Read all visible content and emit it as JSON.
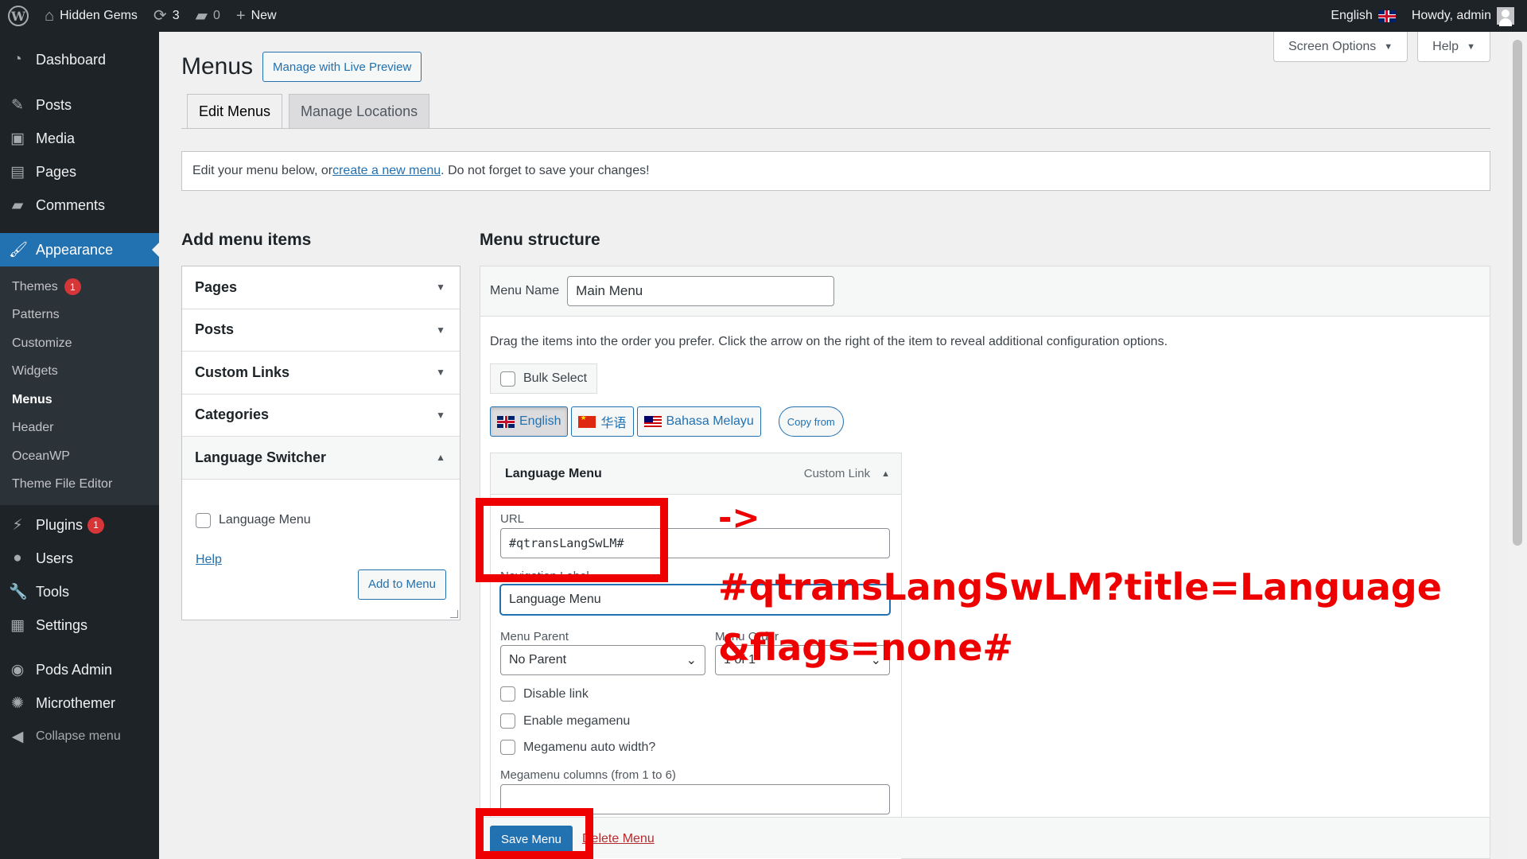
{
  "adminbar": {
    "site_name": "Hidden Gems",
    "updates_count": "3",
    "comments_count": "0",
    "new_label": "New",
    "language": "English",
    "howdy": "Howdy, admin"
  },
  "sidebar": {
    "dashboard": "Dashboard",
    "posts": "Posts",
    "media": "Media",
    "pages": "Pages",
    "comments": "Comments",
    "appearance": "Appearance",
    "sub": {
      "themes": "Themes",
      "themes_badge": "1",
      "patterns": "Patterns",
      "customize": "Customize",
      "widgets": "Widgets",
      "menus": "Menus",
      "header": "Header",
      "oceanwp": "OceanWP",
      "theme_file_editor": "Theme File Editor"
    },
    "plugins": "Plugins",
    "plugins_badge": "1",
    "users": "Users",
    "tools": "Tools",
    "settings": "Settings",
    "pods_admin": "Pods Admin",
    "microthemer": "Microthemer",
    "collapse": "Collapse menu"
  },
  "screen_meta": {
    "screen_options": "Screen Options",
    "help": "Help"
  },
  "page": {
    "title": "Menus",
    "live_preview": "Manage with Live Preview",
    "tabs": [
      "Edit Menus",
      "Manage Locations"
    ],
    "notice_prefix": "Edit your menu below, or ",
    "notice_link": "create a new menu",
    "notice_suffix": ". Do not forget to save your changes!"
  },
  "add_items": {
    "heading": "Add menu items",
    "sections": [
      "Pages",
      "Posts",
      "Custom Links",
      "Categories",
      "Language Switcher"
    ],
    "checkbox_label": "Language Menu",
    "help": "Help",
    "add_button": "Add to Menu"
  },
  "structure": {
    "heading": "Menu structure",
    "menu_name_label": "Menu Name",
    "menu_name_value": "Main Menu",
    "instruction": "Drag the items into the order you prefer. Click the arrow on the right of the item to reveal additional configuration options.",
    "bulk_select": "Bulk Select",
    "languages": [
      "English",
      "华语",
      "Bahasa Melayu"
    ],
    "copy_from": "Copy from",
    "item": {
      "title": "Language Menu",
      "type": "Custom Link",
      "url_label": "URL",
      "url_value": "#qtransLangSwLM#",
      "nav_label_label": "Navigation Label",
      "nav_label_value": "Language Menu",
      "parent_label": "Menu Parent",
      "parent_value": "No Parent",
      "order_label": "Menu Order",
      "order_value": "1 of 1",
      "disable_link": "Disable link",
      "enable_megamenu": "Enable megamenu",
      "megamenu_auto": "Megamenu auto width?",
      "megamenu_columns": "Megamenu columns (from 1 to 6)"
    },
    "save": "Save Menu",
    "delete": "Delete Menu"
  },
  "annotation": {
    "arrow": "->",
    "line1": "#qtransLangSwLM?title=Language",
    "line2": "&flags=none#"
  },
  "colors": {
    "admin_dark": "#1d2327",
    "accent": "#2271b1",
    "annotation_red": "#ee0000"
  }
}
